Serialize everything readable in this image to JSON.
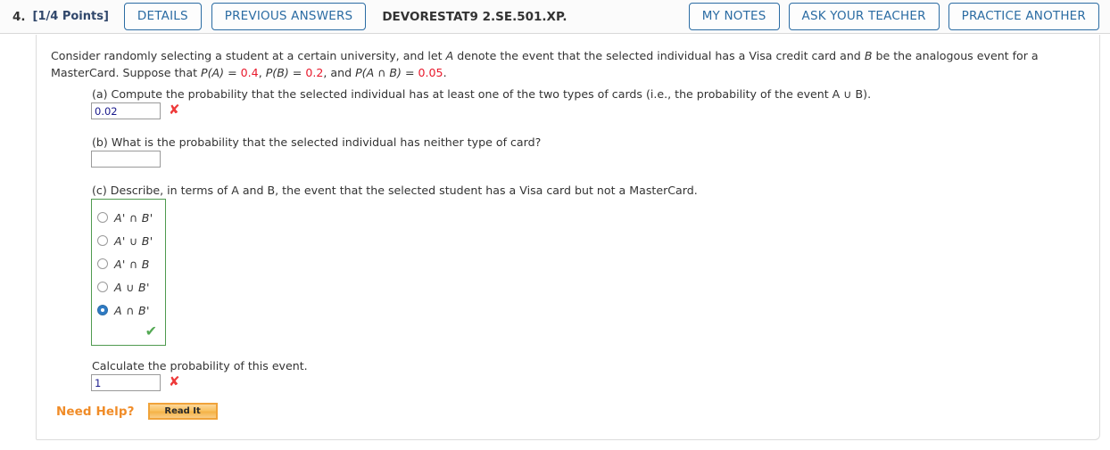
{
  "header": {
    "question_number": "4.",
    "points": "[1/4 Points]",
    "details_label": "DETAILS",
    "previous_answers_label": "PREVIOUS ANSWERS",
    "assignment_code": "DEVORESTAT9 2.SE.501.XP.",
    "my_notes_label": "MY NOTES",
    "ask_teacher_label": "ASK YOUR TEACHER",
    "practice_another_label": "PRACTICE ANOTHER",
    "accent_color": "#2b6ca3"
  },
  "problem": {
    "stem_part1": "Consider randomly selecting a student at a certain university, and let ",
    "stem_var_a": "A",
    "stem_part2": " denote the event that the selected individual has a Visa credit card and ",
    "stem_var_b": "B",
    "stem_part3": " be the analogous event for a MasterCard. Suppose that ",
    "pa_label": "P(A)",
    "eq1": " = ",
    "pa_value": "0.4",
    "comma1": ", ",
    "pb_label": "P(B)",
    "eq2": " = ",
    "pb_value": "0.2",
    "comma2": ", and ",
    "pab_label": "P(A ∩ B)",
    "eq3": " = ",
    "pab_value": "0.05",
    "period": "."
  },
  "parts": {
    "a": {
      "text": "(a) Compute the probability that the selected individual has at least one of the two types of cards (i.e., the probability of the event A ∪ B).",
      "answer_value": "0.02",
      "status_icon": "x-mark-incorrect"
    },
    "b": {
      "text": "(b) What is the probability that the selected individual has neither type of card?",
      "answer_value": "",
      "placeholder": ""
    },
    "c": {
      "text": "(c) Describe, in terms of A and B, the event that the selected student has a Visa card but not a MasterCard.",
      "options": [
        {
          "label": "A' ∩ B'",
          "selected": false
        },
        {
          "label": "A' ∪ B'",
          "selected": false
        },
        {
          "label": "A' ∩ B",
          "selected": false
        },
        {
          "label": "A ∪ B'",
          "selected": false
        },
        {
          "label": "A ∩ B'",
          "selected": true
        }
      ],
      "status_icon": "check-mark-correct",
      "checkmark_color": "#54a954",
      "box_border_color": "#4f9a4f"
    }
  },
  "calculate": {
    "prompt": "Calculate the probability of this event.",
    "answer_value": "1",
    "status_icon": "x-mark-incorrect"
  },
  "need_help": {
    "label": "Need Help?",
    "read_it_label": "Read It",
    "label_color": "#f08c28"
  },
  "icons": {
    "x_mark": "✘",
    "check_mark": "✔"
  }
}
